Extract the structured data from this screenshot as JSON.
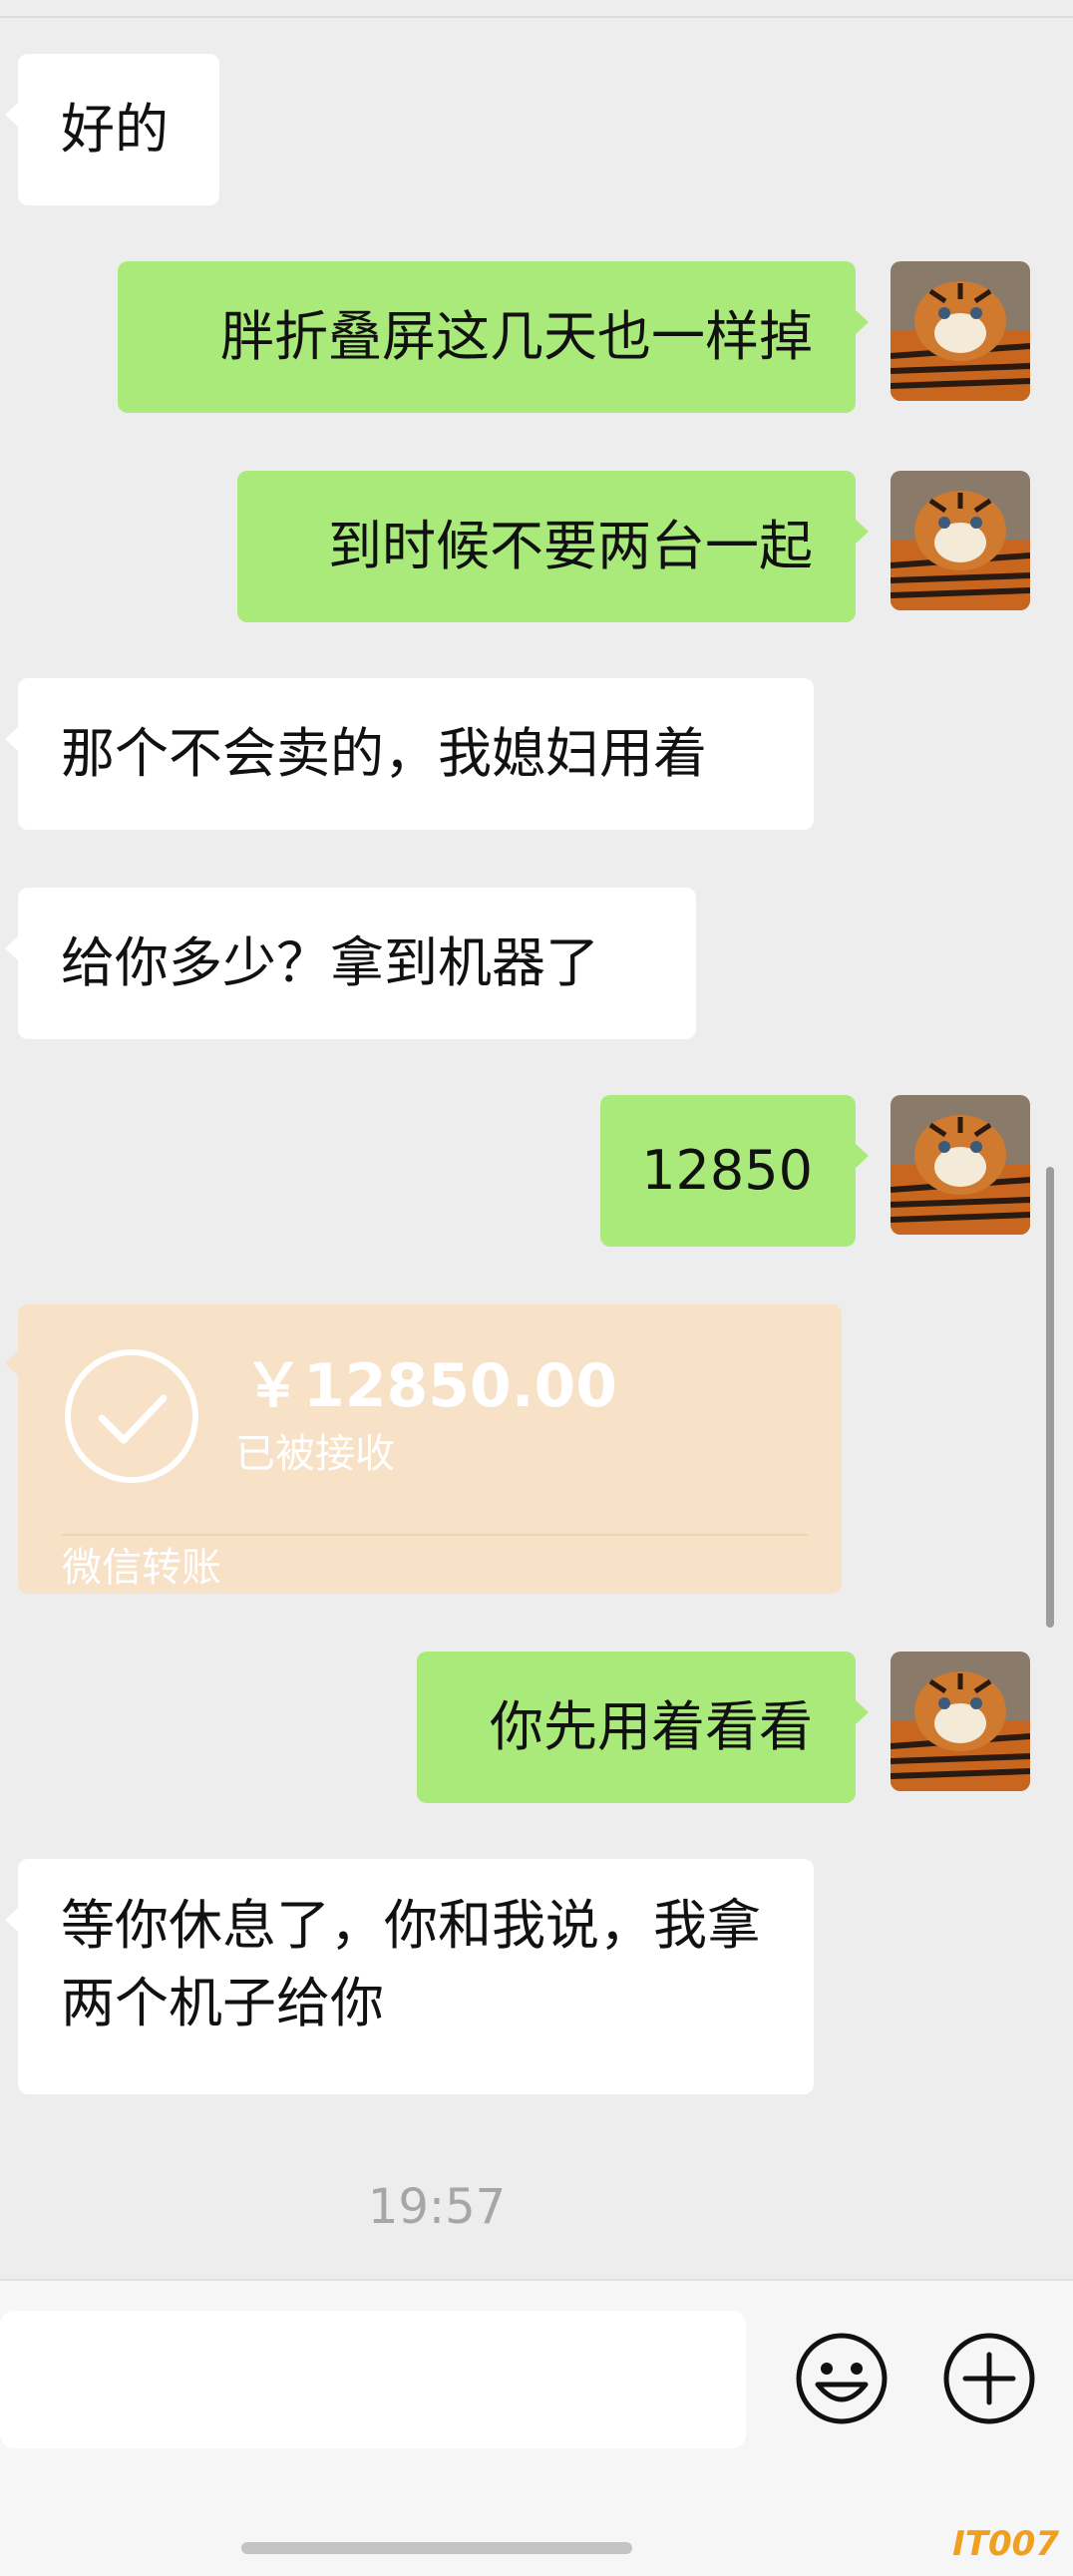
{
  "messages": [
    {
      "text": "好的"
    },
    {
      "text": "胖折叠屏这几天也一样掉"
    },
    {
      "text": "到时候不要两台一起"
    },
    {
      "text": "那个不会卖的，我媳妇用着"
    },
    {
      "text": "给你多少？拿到机器了"
    },
    {
      "text": "12850"
    },
    {
      "text": "你先用着看看"
    },
    {
      "text": "等你休息了，你和我说，我拿两个机子给你"
    }
  ],
  "transfer": {
    "amount": "￥12850.00",
    "status": "已被接收",
    "label": "微信转账"
  },
  "timestamp": "19:57",
  "input_bar": {
    "emoji_icon": "smiley-icon",
    "add_icon": "plus-circle-icon"
  },
  "watermark": "IT007",
  "colors": {
    "background": "#ededed",
    "incoming_bubble": "#ffffff",
    "outgoing_bubble": "#a9ea7a",
    "transfer_card": "#f7e1c7"
  }
}
